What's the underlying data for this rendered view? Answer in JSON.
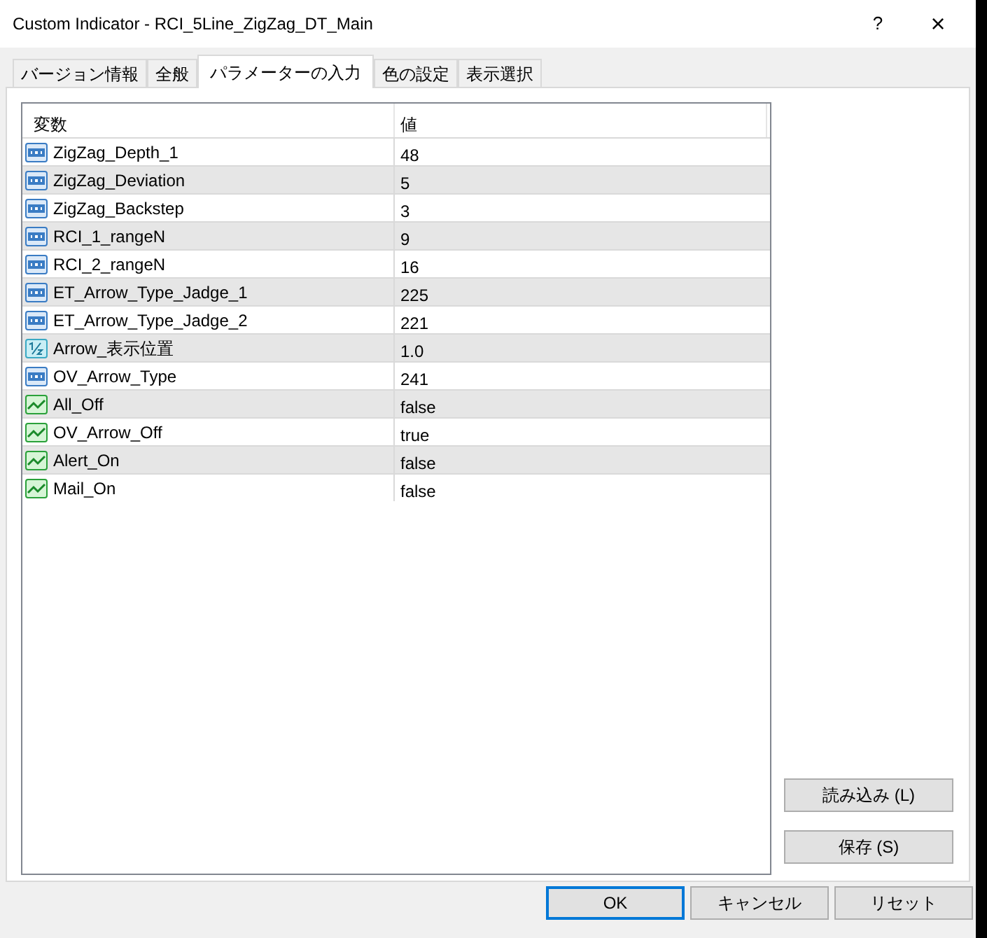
{
  "window": {
    "title": "Custom Indicator - RCI_5Line_ZigZag_DT_Main",
    "help": "?",
    "close": "×"
  },
  "tabs": [
    {
      "label": "バージョン情報",
      "selected": false
    },
    {
      "label": "全般",
      "selected": false
    },
    {
      "label": "パラメーターの入力",
      "selected": true
    },
    {
      "label": "色の設定",
      "selected": false
    },
    {
      "label": "表示選択",
      "selected": false
    }
  ],
  "table": {
    "columns": [
      "変数",
      "値"
    ],
    "rows": [
      {
        "kind": "int",
        "name": "ZigZag_Depth_1",
        "value": "48"
      },
      {
        "kind": "int",
        "name": "ZigZag_Deviation",
        "value": "5"
      },
      {
        "kind": "int",
        "name": "ZigZag_Backstep",
        "value": "3"
      },
      {
        "kind": "int",
        "name": "RCI_1_rangeN",
        "value": "9"
      },
      {
        "kind": "int",
        "name": "RCI_2_rangeN",
        "value": "16"
      },
      {
        "kind": "int",
        "name": "ET_Arrow_Type_Jadge_1",
        "value": "225"
      },
      {
        "kind": "int",
        "name": "ET_Arrow_Type_Jadge_2",
        "value": "221"
      },
      {
        "kind": "double",
        "name": "Arrow_表示位置",
        "value": "1.0"
      },
      {
        "kind": "int",
        "name": "OV_Arrow_Type",
        "value": "241"
      },
      {
        "kind": "bool",
        "name": "All_Off",
        "value": "false"
      },
      {
        "kind": "bool",
        "name": "OV_Arrow_Off",
        "value": "true"
      },
      {
        "kind": "bool",
        "name": "Alert_On",
        "value": "false"
      },
      {
        "kind": "bool",
        "name": "Mail_On",
        "value": "false"
      }
    ]
  },
  "side_buttons": [
    "読み込み (L)",
    "保存 (S)"
  ],
  "buttons": [
    {
      "label": "OK",
      "default": true
    },
    {
      "label": "キャンセル",
      "default": false
    },
    {
      "label": "リセット",
      "default": false
    }
  ]
}
